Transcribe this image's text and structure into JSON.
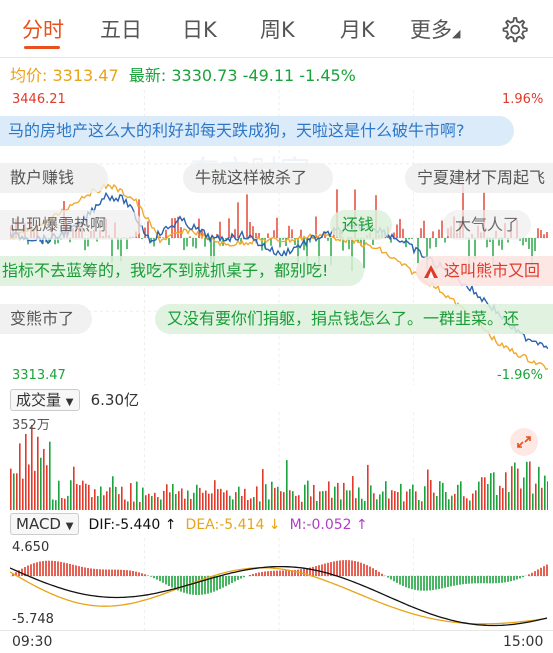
{
  "tabs": [
    {
      "label": "分时",
      "active": true
    },
    {
      "label": "五日",
      "active": false
    },
    {
      "label": "日K",
      "active": false
    },
    {
      "label": "周K",
      "active": false
    },
    {
      "label": "月K",
      "active": false
    },
    {
      "label": "更多",
      "active": false
    }
  ],
  "settings_icon": "gear-icon",
  "quote": {
    "avg_label": "均价:",
    "avg_value": "3313.47",
    "last_label": "最新:",
    "last_value": "3330.73",
    "change": "-49.11",
    "change_pct": "-1.45%"
  },
  "price_chart": {
    "high_label": "3446.21",
    "high_pct": "1.96%",
    "low_label": "3313.47",
    "low_pct": "-1.96%",
    "watermark": "东方财富",
    "colors": {
      "price_line": "#2b63b0",
      "avg_line": "#f0a92b",
      "up": "#e03a2a",
      "down": "#1aa33a"
    }
  },
  "danmu": [
    {
      "text": "马的房地产这么大的利好却每天跌成狗，天啦这是什么破牛市啊?",
      "style": "blue"
    },
    {
      "text": "散户赚钱",
      "style": "gray"
    },
    {
      "text": "牛就这样被杀了",
      "style": "gray"
    },
    {
      "text": "宁夏建材下周起飞",
      "style": "gray"
    },
    {
      "text": "出现爆雷热啊",
      "style": "gray"
    },
    {
      "text": "还钱",
      "style": "green"
    },
    {
      "text": "大气人了",
      "style": "gray"
    },
    {
      "text": "指标不去蓝筹的，我吃不到就抓桌子，都别吃!",
      "style": "green"
    },
    {
      "text": "这叫熊市又回",
      "style": "red"
    },
    {
      "text": "变熊市了",
      "style": "gray"
    },
    {
      "text": "又没有要你们捐躯，捐点钱怎么了。一群韭菜。还",
      "style": "green"
    }
  ],
  "volume": {
    "label": "成交量",
    "total": "6.30亿",
    "max_label": "352万",
    "expand_icon": "expand-icon"
  },
  "macd": {
    "label": "MACD",
    "dif": "DIF:-5.440 ↑",
    "dea": "DEA:-5.414 ↓",
    "m": "M:-0.052 ↑",
    "high_label": "4.650",
    "low_label": "-5.748",
    "colors": {
      "dif": "#111111",
      "dea": "#e8a419",
      "m": "#b43dc8"
    }
  },
  "time_axis": {
    "start": "09:30",
    "end": "15:00"
  }
}
